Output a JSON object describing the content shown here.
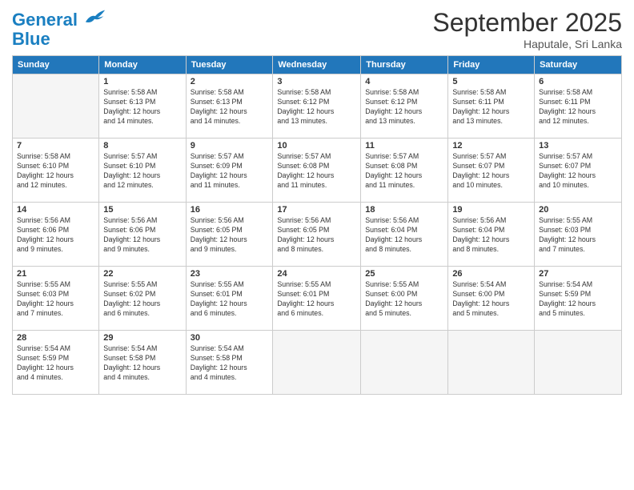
{
  "logo": {
    "line1": "General",
    "line2": "Blue"
  },
  "title": "September 2025",
  "subtitle": "Haputale, Sri Lanka",
  "days_header": [
    "Sunday",
    "Monday",
    "Tuesday",
    "Wednesday",
    "Thursday",
    "Friday",
    "Saturday"
  ],
  "weeks": [
    [
      {
        "num": "",
        "info": ""
      },
      {
        "num": "1",
        "info": "Sunrise: 5:58 AM\nSunset: 6:13 PM\nDaylight: 12 hours\nand 14 minutes."
      },
      {
        "num": "2",
        "info": "Sunrise: 5:58 AM\nSunset: 6:13 PM\nDaylight: 12 hours\nand 14 minutes."
      },
      {
        "num": "3",
        "info": "Sunrise: 5:58 AM\nSunset: 6:12 PM\nDaylight: 12 hours\nand 13 minutes."
      },
      {
        "num": "4",
        "info": "Sunrise: 5:58 AM\nSunset: 6:12 PM\nDaylight: 12 hours\nand 13 minutes."
      },
      {
        "num": "5",
        "info": "Sunrise: 5:58 AM\nSunset: 6:11 PM\nDaylight: 12 hours\nand 13 minutes."
      },
      {
        "num": "6",
        "info": "Sunrise: 5:58 AM\nSunset: 6:11 PM\nDaylight: 12 hours\nand 12 minutes."
      }
    ],
    [
      {
        "num": "7",
        "info": "Sunrise: 5:58 AM\nSunset: 6:10 PM\nDaylight: 12 hours\nand 12 minutes."
      },
      {
        "num": "8",
        "info": "Sunrise: 5:57 AM\nSunset: 6:10 PM\nDaylight: 12 hours\nand 12 minutes."
      },
      {
        "num": "9",
        "info": "Sunrise: 5:57 AM\nSunset: 6:09 PM\nDaylight: 12 hours\nand 11 minutes."
      },
      {
        "num": "10",
        "info": "Sunrise: 5:57 AM\nSunset: 6:08 PM\nDaylight: 12 hours\nand 11 minutes."
      },
      {
        "num": "11",
        "info": "Sunrise: 5:57 AM\nSunset: 6:08 PM\nDaylight: 12 hours\nand 11 minutes."
      },
      {
        "num": "12",
        "info": "Sunrise: 5:57 AM\nSunset: 6:07 PM\nDaylight: 12 hours\nand 10 minutes."
      },
      {
        "num": "13",
        "info": "Sunrise: 5:57 AM\nSunset: 6:07 PM\nDaylight: 12 hours\nand 10 minutes."
      }
    ],
    [
      {
        "num": "14",
        "info": "Sunrise: 5:56 AM\nSunset: 6:06 PM\nDaylight: 12 hours\nand 9 minutes."
      },
      {
        "num": "15",
        "info": "Sunrise: 5:56 AM\nSunset: 6:06 PM\nDaylight: 12 hours\nand 9 minutes."
      },
      {
        "num": "16",
        "info": "Sunrise: 5:56 AM\nSunset: 6:05 PM\nDaylight: 12 hours\nand 9 minutes."
      },
      {
        "num": "17",
        "info": "Sunrise: 5:56 AM\nSunset: 6:05 PM\nDaylight: 12 hours\nand 8 minutes."
      },
      {
        "num": "18",
        "info": "Sunrise: 5:56 AM\nSunset: 6:04 PM\nDaylight: 12 hours\nand 8 minutes."
      },
      {
        "num": "19",
        "info": "Sunrise: 5:56 AM\nSunset: 6:04 PM\nDaylight: 12 hours\nand 8 minutes."
      },
      {
        "num": "20",
        "info": "Sunrise: 5:55 AM\nSunset: 6:03 PM\nDaylight: 12 hours\nand 7 minutes."
      }
    ],
    [
      {
        "num": "21",
        "info": "Sunrise: 5:55 AM\nSunset: 6:03 PM\nDaylight: 12 hours\nand 7 minutes."
      },
      {
        "num": "22",
        "info": "Sunrise: 5:55 AM\nSunset: 6:02 PM\nDaylight: 12 hours\nand 6 minutes."
      },
      {
        "num": "23",
        "info": "Sunrise: 5:55 AM\nSunset: 6:01 PM\nDaylight: 12 hours\nand 6 minutes."
      },
      {
        "num": "24",
        "info": "Sunrise: 5:55 AM\nSunset: 6:01 PM\nDaylight: 12 hours\nand 6 minutes."
      },
      {
        "num": "25",
        "info": "Sunrise: 5:55 AM\nSunset: 6:00 PM\nDaylight: 12 hours\nand 5 minutes."
      },
      {
        "num": "26",
        "info": "Sunrise: 5:54 AM\nSunset: 6:00 PM\nDaylight: 12 hours\nand 5 minutes."
      },
      {
        "num": "27",
        "info": "Sunrise: 5:54 AM\nSunset: 5:59 PM\nDaylight: 12 hours\nand 5 minutes."
      }
    ],
    [
      {
        "num": "28",
        "info": "Sunrise: 5:54 AM\nSunset: 5:59 PM\nDaylight: 12 hours\nand 4 minutes."
      },
      {
        "num": "29",
        "info": "Sunrise: 5:54 AM\nSunset: 5:58 PM\nDaylight: 12 hours\nand 4 minutes."
      },
      {
        "num": "30",
        "info": "Sunrise: 5:54 AM\nSunset: 5:58 PM\nDaylight: 12 hours\nand 4 minutes."
      },
      {
        "num": "",
        "info": ""
      },
      {
        "num": "",
        "info": ""
      },
      {
        "num": "",
        "info": ""
      },
      {
        "num": "",
        "info": ""
      }
    ]
  ]
}
